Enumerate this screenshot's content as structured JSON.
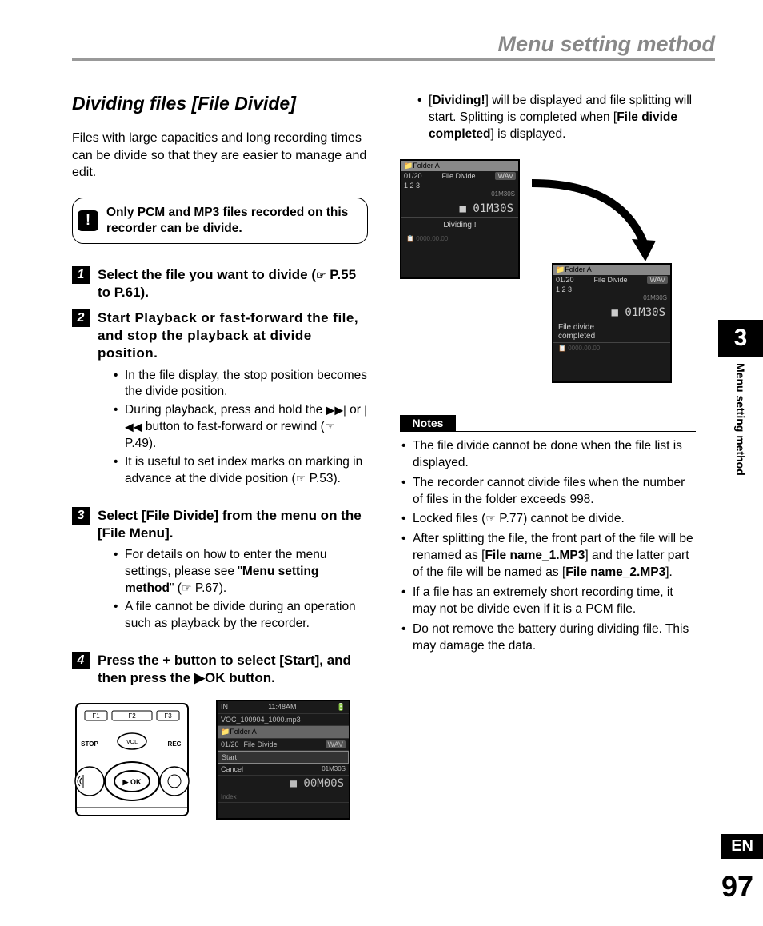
{
  "header": {
    "title": "Menu setting method"
  },
  "section": {
    "title": "Dividing files [File Divide]"
  },
  "intro": "Files with large capacities and long recording times can be divide so that they are easier to manage and edit.",
  "noteBox": {
    "icon": "!",
    "text": "Only PCM and MP3 files recorded on this recorder can be divide."
  },
  "steps": [
    {
      "num": "1",
      "title_pre": "Select the file you want to divide (",
      "title_ptr": "☞",
      "title_post": " P.55 to P.61).",
      "bullets": []
    },
    {
      "num": "2",
      "title_full": "Start Playback or fast-forward the file, and stop the playback at divide position.",
      "bullets": [
        {
          "text": "In the file display, the stop position becomes the divide position."
        },
        {
          "pre": "During playback, press and hold the ",
          "icon1": "▶▶|",
          "mid": " or ",
          "icon2": "|◀◀",
          "post1": " button to fast-forward or rewind (",
          "ptr": "☞",
          "post2": " P.49)."
        },
        {
          "pre": "It is useful to set index marks on marking in advance at the divide position (",
          "ptr": "☞",
          "post": " P.53)."
        }
      ]
    },
    {
      "num": "3",
      "title_pre": "Select [",
      "title_bold1": "File Divide",
      "title_mid": "] from the menu on the [",
      "title_bold2": "File Menu",
      "title_post": "].",
      "bullets": [
        {
          "pre": "For details on how to enter the menu settings, please see \"",
          "bold": "Menu setting method",
          "post1": "\" (",
          "ptr": "☞",
          "post2": " P.67)."
        },
        {
          "text": "A file cannot be divide during an operation such as playback by the recorder."
        }
      ]
    },
    {
      "num": "4",
      "title_pre": "Press the ",
      "title_bold1": "+",
      "title_mid1": " button to select [",
      "title_bold2": "Start",
      "title_mid2": "], and then press the ",
      "title_icon": "▶",
      "title_bold3": "OK",
      "title_post": " button.",
      "bullets": []
    }
  ],
  "rightTop": {
    "pre": "[",
    "bold1": "Dividing!",
    "mid1": "] will be displayed and file splitting will start. Splitting is completed when [",
    "bold2": "File divide completed",
    "post": "] is displayed."
  },
  "screen1": {
    "folder": "📁Folder A",
    "row1a": "01/20",
    "row1b": "File Divide",
    "row1c": "WAV",
    "row2": "1  2  3",
    "time_small": "01M30S",
    "big": "01M30S",
    "stop": "■",
    "status": "Dividing !",
    "bottom": "0000.00.00"
  },
  "screen2": {
    "folder": "📁Folder A",
    "row1a": "01/20",
    "row1b": "File Divide",
    "row1c": "WAV",
    "row2": "1  2  3",
    "time_small": "01M30S",
    "big": "01M30S",
    "stop": "■",
    "status1": "File divide",
    "status2": "completed",
    "bottom": "0000.00.00"
  },
  "notes": {
    "header": "Notes",
    "items": [
      {
        "text": "The file divide cannot be done when the file list is displayed."
      },
      {
        "text": "The recorder cannot divide files when the number of files in the folder exceeds 998."
      },
      {
        "pre": "Locked files (",
        "ptr": "☞",
        "post": " P.77) cannot be divide."
      },
      {
        "pre": "After splitting the file, the front part of the file will be renamed as [",
        "bold1": "File name_1.MP3",
        "mid": "] and the latter part of the file will be named as [",
        "bold2": "File name_2.MP3",
        "post": "]."
      },
      {
        "text": "If a file has an extremely short recording time, it may not be divide even if it is a PCM file."
      },
      {
        "text": "Do not remove the battery during dividing file. This may damage the data."
      }
    ]
  },
  "device": {
    "f1": "F1",
    "f2": "F2",
    "f3": "F3",
    "stop": "STOP",
    "vol": "VOL",
    "rec": "REC",
    "ok": "▶ OK"
  },
  "miniScreen": {
    "top1": "IN",
    "time": "11:48AM",
    "file": "VOC_100904_1000.mp3",
    "folder": "📁Folder A",
    "r1a": "01/20",
    "r1b": "File Divide",
    "r1c": "WAV",
    "start": "Start",
    "cancel": "Cancel",
    "t2": "01M30S",
    "big": "00M00S",
    "bottom": "Index"
  },
  "sideTab": {
    "chapter": "3",
    "label": "Menu setting method"
  },
  "langBadge": "EN",
  "pageNum": "97"
}
